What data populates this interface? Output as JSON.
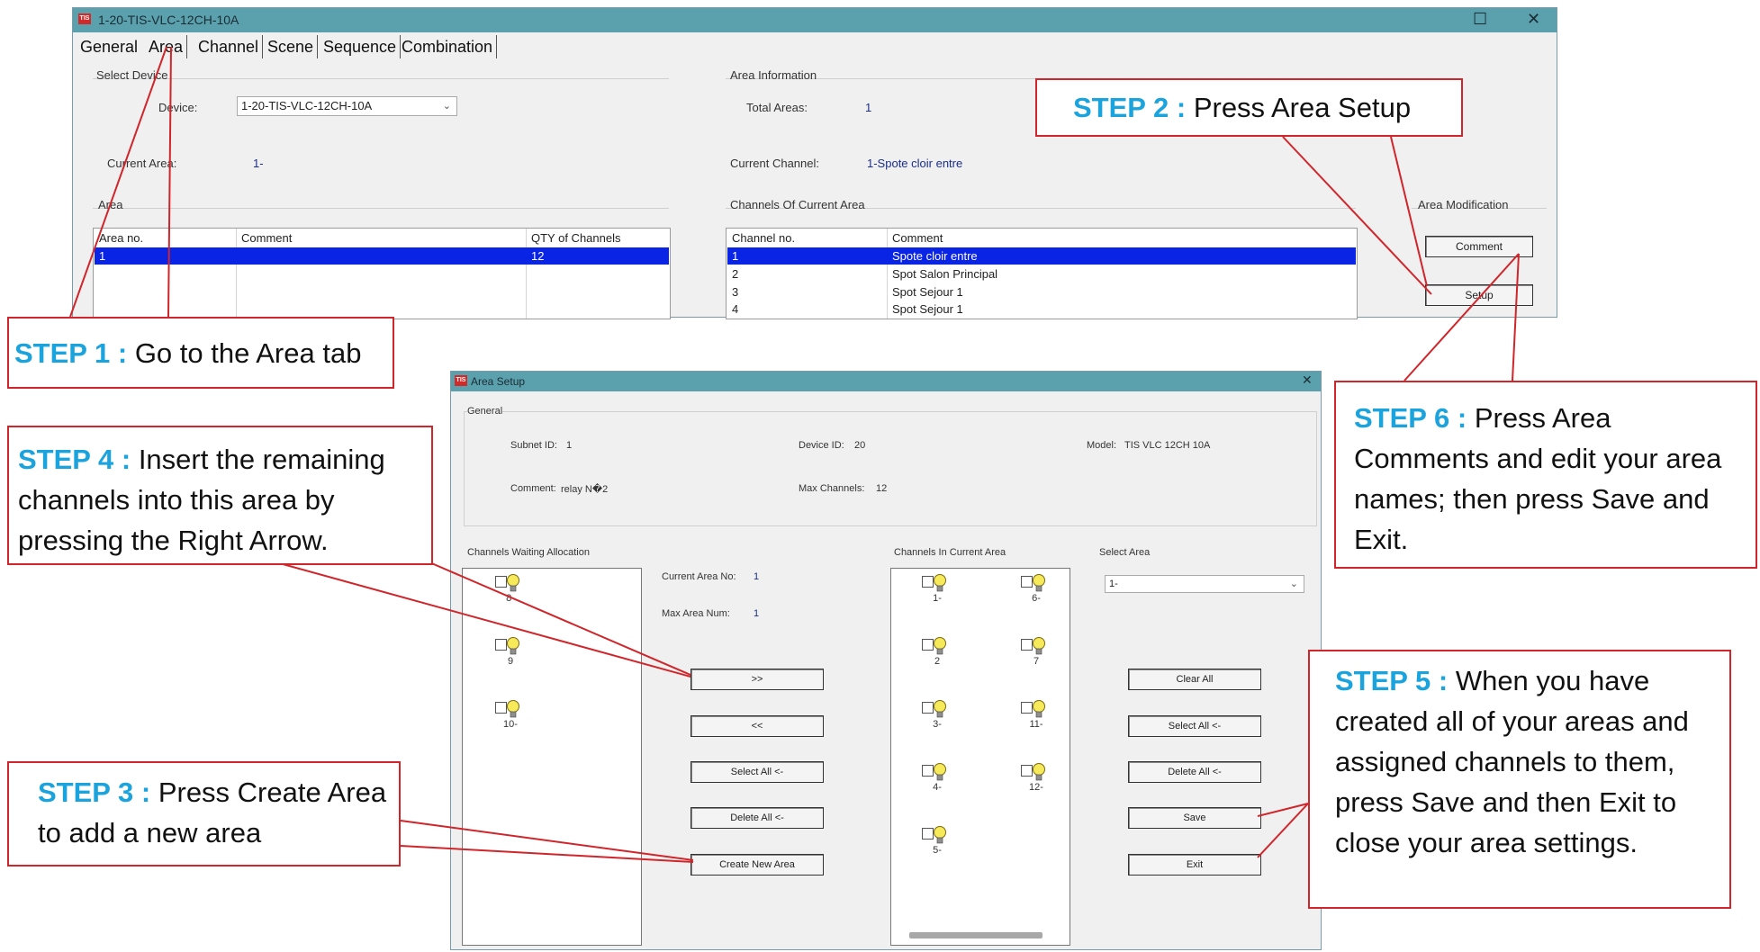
{
  "main_window": {
    "title": "1-20-TIS-VLC-12CH-10A",
    "maximize_icon": "☐",
    "close_icon": "✕",
    "tabs": [
      {
        "label": "General"
      },
      {
        "label": "Area"
      },
      {
        "label": "Channel"
      },
      {
        "label": "Scene"
      },
      {
        "label": "Sequence"
      },
      {
        "label": "Combination"
      }
    ],
    "select_device_group": "Select Device",
    "device_label": "Device:",
    "device_value": "1-20-TIS-VLC-12CH-10A",
    "current_area_label": "Current Area:",
    "current_area_value": "1-",
    "area_info_group": "Area Information",
    "total_areas_label": "Total Areas:",
    "total_areas_value": "1",
    "current_channel_label": "Current Channel:",
    "current_channel_value": "1-Spote cloir entre",
    "area_group": "Area",
    "area_table": {
      "headers": [
        "Area no.",
        "Comment",
        "QTY of Channels"
      ],
      "rows": [
        [
          "1",
          "",
          "12"
        ]
      ]
    },
    "channels_group": "Channels Of Current Area",
    "channels_table": {
      "headers": [
        "Channel no.",
        "Comment"
      ],
      "rows": [
        [
          "1",
          "Spote cloir entre"
        ],
        [
          "2",
          "Spot Salon Principal"
        ],
        [
          "3",
          "Spot Sejour 1"
        ],
        [
          "4",
          "Spot Sejour 1"
        ]
      ]
    },
    "area_modification_group": "Area Modification",
    "comment_button": "Comment",
    "setup_button": "Setup"
  },
  "area_setup_dialog": {
    "title": "Area Setup",
    "close_icon": "✕",
    "general_group": "General",
    "subnet_label": "Subnet ID:",
    "subnet_value": "1",
    "device_id_label": "Device ID:",
    "device_id_value": "20",
    "model_label": "Model:",
    "model_value": "TIS VLC 12CH 10A",
    "comment_label": "Comment:",
    "comment_value": "relay N�2",
    "max_channels_label": "Max Channels:",
    "max_channels_value": "12",
    "waiting_label": "Channels Waiting Allocation",
    "waiting_channels": [
      "8-",
      "9",
      "10-"
    ],
    "current_area_no_label": "Current Area No:",
    "current_area_no_value": "1",
    "max_area_num_label": "Max Area Num:",
    "max_area_num_value": "1",
    "move_right_button": ">>",
    "move_left_button": "<<",
    "select_all_button": "Select All <-",
    "delete_all_button": "Delete All <-",
    "create_area_button": "Create New Area",
    "in_area_label": "Channels In Current Area",
    "in_area_channels": [
      "1-",
      "6-",
      "2",
      "7",
      "3-",
      "11-",
      "4-",
      "12-",
      "5-"
    ],
    "select_area_label": "Select Area",
    "select_area_value": "1-",
    "clear_all_button": "Clear All",
    "select_all_right_button": "Select All <-",
    "delete_all_right_button": "Delete All <-",
    "save_button": "Save",
    "exit_button": "Exit"
  },
  "callouts": {
    "step1": {
      "tag": "STEP 1 :",
      "text": " Go to the Area tab"
    },
    "step2": {
      "tag": "STEP 2 :",
      "text": " Press Area Setup"
    },
    "step3": {
      "tag": "STEP 3 :",
      "text": " Press Create Area to add a new area"
    },
    "step4": {
      "tag": "STEP 4 :",
      "text": " Insert the remaining channels into this area by pressing the Right Arrow."
    },
    "step5": {
      "tag": "STEP 5 :",
      "text": " When you have created all of your areas and assigned channels to them, press Save and then Exit to close your area settings."
    },
    "step6": {
      "tag": "STEP 6 :",
      "text": "  Press Area Comments and edit your area names; then press Save and Exit."
    }
  },
  "colors": {
    "titlebar": "#5aa1ad",
    "selection": "#0a24e6",
    "callout_border": "#d0252a",
    "step_tag": "#1aa3dd"
  }
}
